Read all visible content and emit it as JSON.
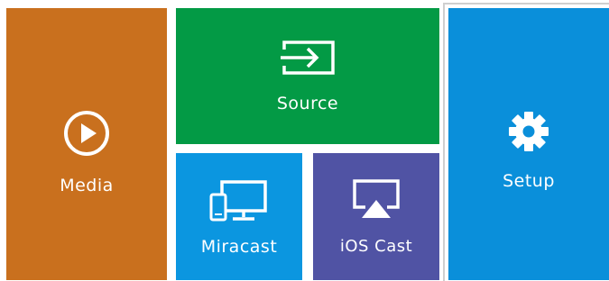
{
  "tiles": {
    "media": {
      "label": "Media",
      "color": "#c9701e",
      "icon": "play-circle-icon"
    },
    "source": {
      "label": "Source",
      "color": "#039a45",
      "icon": "input-source-icon"
    },
    "miracast": {
      "label": "Miracast",
      "color": "#0b96e0",
      "icon": "screen-mirror-icon"
    },
    "ioscast": {
      "label": "iOS Cast",
      "color": "#5053a4",
      "icon": "airplay-icon"
    },
    "setup": {
      "label": "Setup",
      "color": "#0a8fda",
      "icon": "gear-icon"
    }
  }
}
